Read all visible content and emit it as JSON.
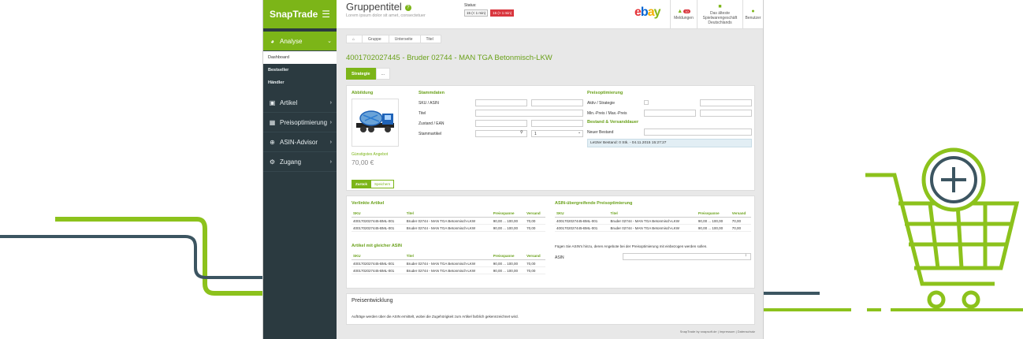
{
  "brand": {
    "name": "SnapTrade"
  },
  "nav": {
    "items": [
      {
        "label": "Analyse"
      },
      {
        "label": "Artikel"
      },
      {
        "label": "Preisoptimierung"
      },
      {
        "label": "ASIN-Advisor"
      },
      {
        "label": "Zugang"
      }
    ],
    "subitems": [
      "Dashboard",
      "Bestseller",
      "Händler"
    ]
  },
  "header": {
    "title": "Gruppentitel",
    "subtitle": "Lorem ipsum dolor sit amet, consectetuer",
    "status_label": "Status:",
    "badge1": "15 (< 1 min)",
    "badge2": "15 (> 1 min)",
    "logo": [
      "e",
      "b",
      "a",
      "y"
    ],
    "notifications": {
      "label": "Meldungen",
      "count": "10"
    },
    "shop": {
      "label": "Das älteste Spielwarengeschäft Deutschlands"
    },
    "user": {
      "label": "Benutzer"
    }
  },
  "breadcrumb": [
    "Gruppe",
    "Unterseite",
    "Titel"
  ],
  "product": {
    "title": "4001702027445 - Bruder 02744 - MAN TGA Betonmisch-LKW"
  },
  "tabs": [
    "Strategie",
    "..."
  ],
  "form": {
    "abbildung": "Abbildung",
    "stammdaten": "Stammdaten",
    "fields": [
      "SKU / ASIN",
      "Titel",
      "Zustand / EAN",
      "Stammartikel"
    ],
    "select_value": "1",
    "preis_heading": "Preisoptimierung",
    "preis_fields": [
      "Aktiv / Strategie",
      "Min.-Preis / Max.-Preis"
    ],
    "bestand_heading": "Bestand & Versanddauer",
    "neuer_bestand": "Neuer Bestand",
    "note": "Letzter Bestand: 0 Stk. - 04.11.2015 15:27:27",
    "offer_label": "Günstigstes Angebot",
    "price": "70,00 €",
    "btn_back": "Zurück",
    "btn_save": "Speichern"
  },
  "tables": {
    "linked_title": "Verlinkte Artikel",
    "same_asin_title": "Artikel mit gleicher ASIN",
    "asin_opt_title": "ASIN-übergreifende Preisoptimierung",
    "columns": [
      "SKU",
      "Titel",
      "Preisspanne",
      "Versand"
    ],
    "rows": [
      [
        "4001702027445-BML-001",
        "Bruder 02744 - MAN TGA Betonmisch-LKW",
        "90,00 ... 100,00",
        "70,00"
      ],
      [
        "4001702027445-BML-001",
        "Bruder 02744 - MAN TGA Betonmisch-LKW",
        "90,00 ... 100,00",
        "70,00"
      ]
    ],
    "asin_help": "Fügen Sie ASIN's hinzu, deren Angebote bei der Preisoptimierung mit einbezogen werden sollen.",
    "asin_label": "ASIN"
  },
  "price_dev": {
    "title": "Preisentwicklung",
    "text": "Aufträge werden über die ASIN ermittelt, wobei die Zugehörigkeit zum Artikel farblich gekennzeichnet wird."
  },
  "footer": "SnapTrade by snapsoft.de | Impressum | Datenschutz",
  "colors": {
    "accent": "#7cb518",
    "sidebar": "#2b3a40",
    "alert": "#d9363e"
  }
}
